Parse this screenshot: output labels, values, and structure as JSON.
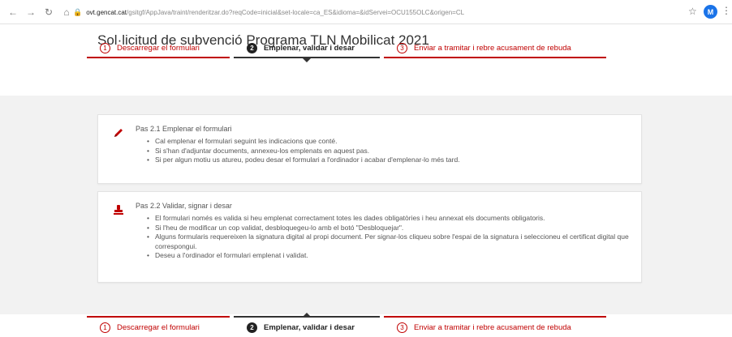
{
  "browser": {
    "back_icon": "arrow-left-icon",
    "forward_icon": "arrow-right-icon",
    "reload_icon": "reload-icon",
    "home_icon": "home-icon",
    "url_host": "ovt.gencat.cat",
    "url_path": "/gsitgf/AppJava/traint/renderitzar.do?reqCode=inicial&set-locale=ca_ES&idioma=&idServei=OCU155OLC&origen=CL",
    "profile_initial": "M"
  },
  "page": {
    "title": "Sol·licitud de subvenció Programa TLN Mobilicat 2021"
  },
  "stepper": {
    "steps": [
      {
        "number": "1",
        "label": "Descarregar el formulari"
      },
      {
        "number": "2",
        "label": "Emplenar, validar i desar"
      },
      {
        "number": "3",
        "label": "Enviar a tramitar i rebre acusament de rebuda"
      }
    ],
    "active_index": 1
  },
  "cards": [
    {
      "icon": "pencil-icon",
      "title": "Pas 2.1 Emplenar el formulari",
      "items": [
        "Cal emplenar el formulari seguint les indicacions que conté.",
        "Si s'han d'adjuntar documents, annexeu-los emplenats en aquest pas.",
        "Si per algun motiu us atureu, podeu desar el formulari a l'ordinador i acabar d'emplenar-lo més tard."
      ]
    },
    {
      "icon": "stamp-icon",
      "title": "Pas 2.2 Validar, signar i desar",
      "items": [
        "El formulari només es valida si heu emplenat correctament totes les dades obligatòries i heu annexat els documents obligatoris.",
        "Si l'heu de modificar un cop validat, desbloquegeu-lo amb el botó \"Desbloquejar\".",
        "Alguns formularis requereixen la signatura digital al propi document. Per signar-los cliqueu sobre l'espai de la signatura i seleccioneu el certificat digital que correspongui.",
        "Deseu a l'ordinador el formulari emplenat i validat."
      ]
    }
  ],
  "colors": {
    "accent": "#c00000",
    "active": "#222222",
    "background": "#f2f2f2"
  }
}
